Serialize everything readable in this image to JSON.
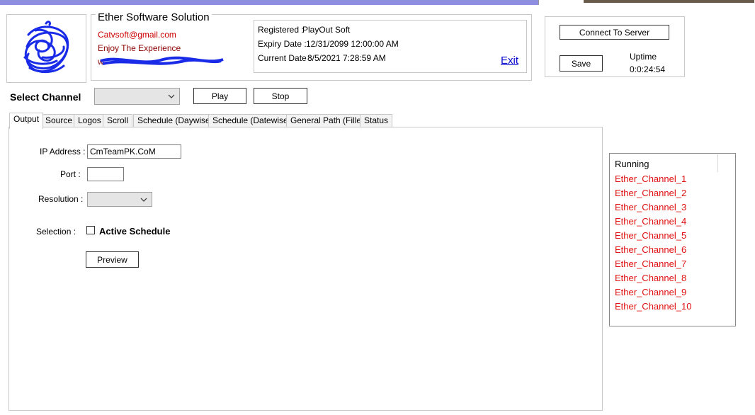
{
  "header": {
    "company": "Ether Software Solution",
    "email": "Catvsoft@gmail.com",
    "tagline": "Enjoy The Experience",
    "website_partial": "w"
  },
  "registration": {
    "registered_label": "Registered :",
    "registered_value": "PlayOut Soft",
    "expiry_label": "Expiry Date :",
    "expiry_value": "12/31/2099 12:00:00 AM",
    "current_label": "Current Date :",
    "current_value": "8/5/2021 7:28:59 AM",
    "exit_link": "Exit"
  },
  "server": {
    "connect_button": "Connect To Server",
    "save_button": "Save",
    "uptime_label": "Uptime",
    "uptime_value": "0:0:24:54"
  },
  "channel_bar": {
    "label": "Select Channel",
    "selected": "",
    "play_button": "Play",
    "stop_button": "Stop"
  },
  "tabs": [
    {
      "label": "Output",
      "active": true
    },
    {
      "label": "Source"
    },
    {
      "label": "Logos"
    },
    {
      "label": "Scroll"
    },
    {
      "label": "Schedule (Daywise)"
    },
    {
      "label": "Schedule (Datewise)"
    },
    {
      "label": "General Path (Filler)"
    },
    {
      "label": "Status"
    }
  ],
  "output": {
    "ip_label": "IP Address :",
    "ip_value": "CmTeamPK.CoM",
    "port_label": "Port :",
    "port_value": "",
    "resolution_label": "Resolution :",
    "resolution_value": "",
    "selection_label": "Selection :",
    "active_schedule_label": "Active Schedule",
    "active_schedule_checked": false,
    "preview_button": "Preview"
  },
  "running": {
    "header": "Running",
    "channels": [
      "Ether_Channel_1",
      "Ether_Channel_2",
      "Ether_Channel_3",
      "Ether_Channel_4",
      "Ether_Channel_5",
      "Ether_Channel_6",
      "Ether_Channel_7",
      "Ether_Channel_8",
      "Ether_Channel_9",
      "Ether_Channel_10"
    ]
  },
  "colors": {
    "title_bar": "#8e8ee0",
    "contact_text": "#cc0000",
    "channel_text": "#e01010",
    "exit_link": "#0000cc",
    "logo_scribble": "#1a2be8"
  }
}
